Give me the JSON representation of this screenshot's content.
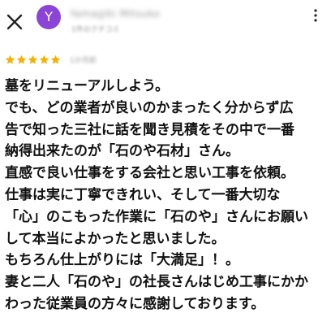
{
  "header": {
    "close_icon": "close-icon",
    "avatar_initial": "Y",
    "avatar_color": "#8b45d6",
    "reviewer_name": "Yamagiki Mitsuko",
    "reviewer_sub": "1件のクチコミ",
    "more_icon": "more-vertical-icon"
  },
  "review": {
    "rating": 5,
    "star_color": "#f6b100",
    "date": "1か月前",
    "lines": [
      "墓をリニューアルしよう。",
      "でも、どの業者が良いのかまったく分からず広",
      "告で知った三社に話を聞き見積をその中で一番",
      "納得出来たのが「石のや石材」さん。",
      "直感で良い仕事をする会社と思い工事を依頼。",
      "仕事は実に丁寧できれい、そして一番大切な",
      "「心」のこもった作業に「石のや」さんにお願い",
      "して本当によかったと思いました。",
      "もちろん仕上がりには「大満足」！。",
      "妻と二人「石のや」の社長さんはじめ工事にかか",
      "わった従業員の方々に感謝しております。"
    ]
  }
}
